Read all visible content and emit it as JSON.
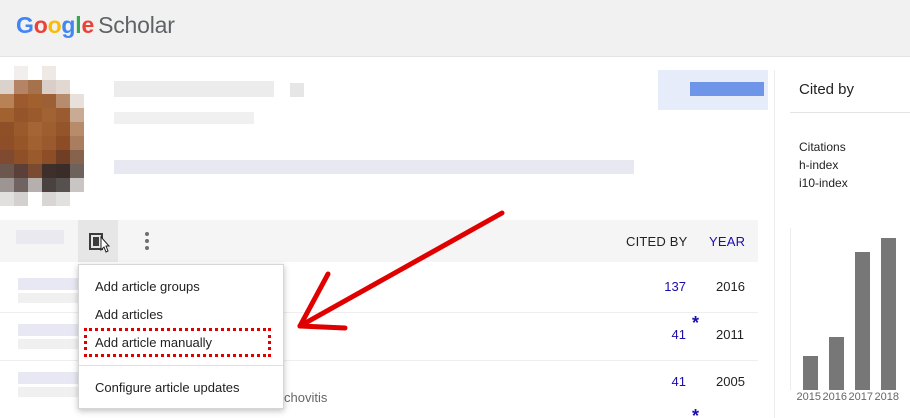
{
  "app": {
    "logo_google": [
      "G",
      "o",
      "o",
      "g",
      "l",
      "e"
    ],
    "logo_google_colors": [
      "#4285f4",
      "#ea4335",
      "#fbbc05",
      "#4285f4",
      "#34a853",
      "#ea4335"
    ],
    "logo_scholar": "Scholar"
  },
  "table": {
    "cited_by_label": "CITED BY",
    "year_label": "YEAR",
    "rows": [
      {
        "cited": "137",
        "year": "2016"
      },
      {
        "cited": "41",
        "year": "2011"
      },
      {
        "cited": "41",
        "year": "2005"
      }
    ],
    "star": "*",
    "author_fragment": "chovitis"
  },
  "menu": {
    "items": [
      "Add article groups",
      "Add articles",
      "Add article manually",
      "Configure article updates"
    ]
  },
  "sidebar": {
    "title": "Cited by",
    "stats": [
      "Citations",
      "h-index",
      "i10-index"
    ]
  },
  "chart_data": {
    "type": "bar",
    "categories": [
      "2015",
      "2016",
      "2017",
      "2018"
    ],
    "values": [
      36,
      56,
      145,
      160
    ],
    "title": "",
    "xlabel": "",
    "ylabel": "",
    "ylim": [
      0,
      170
    ],
    "bar_color": "#777777"
  },
  "colors": {
    "link": "#1a0dab",
    "annotation": "#e00000"
  },
  "icons": {
    "toolbar_tool": "add-article-icon",
    "more": "more-vert-icon"
  }
}
